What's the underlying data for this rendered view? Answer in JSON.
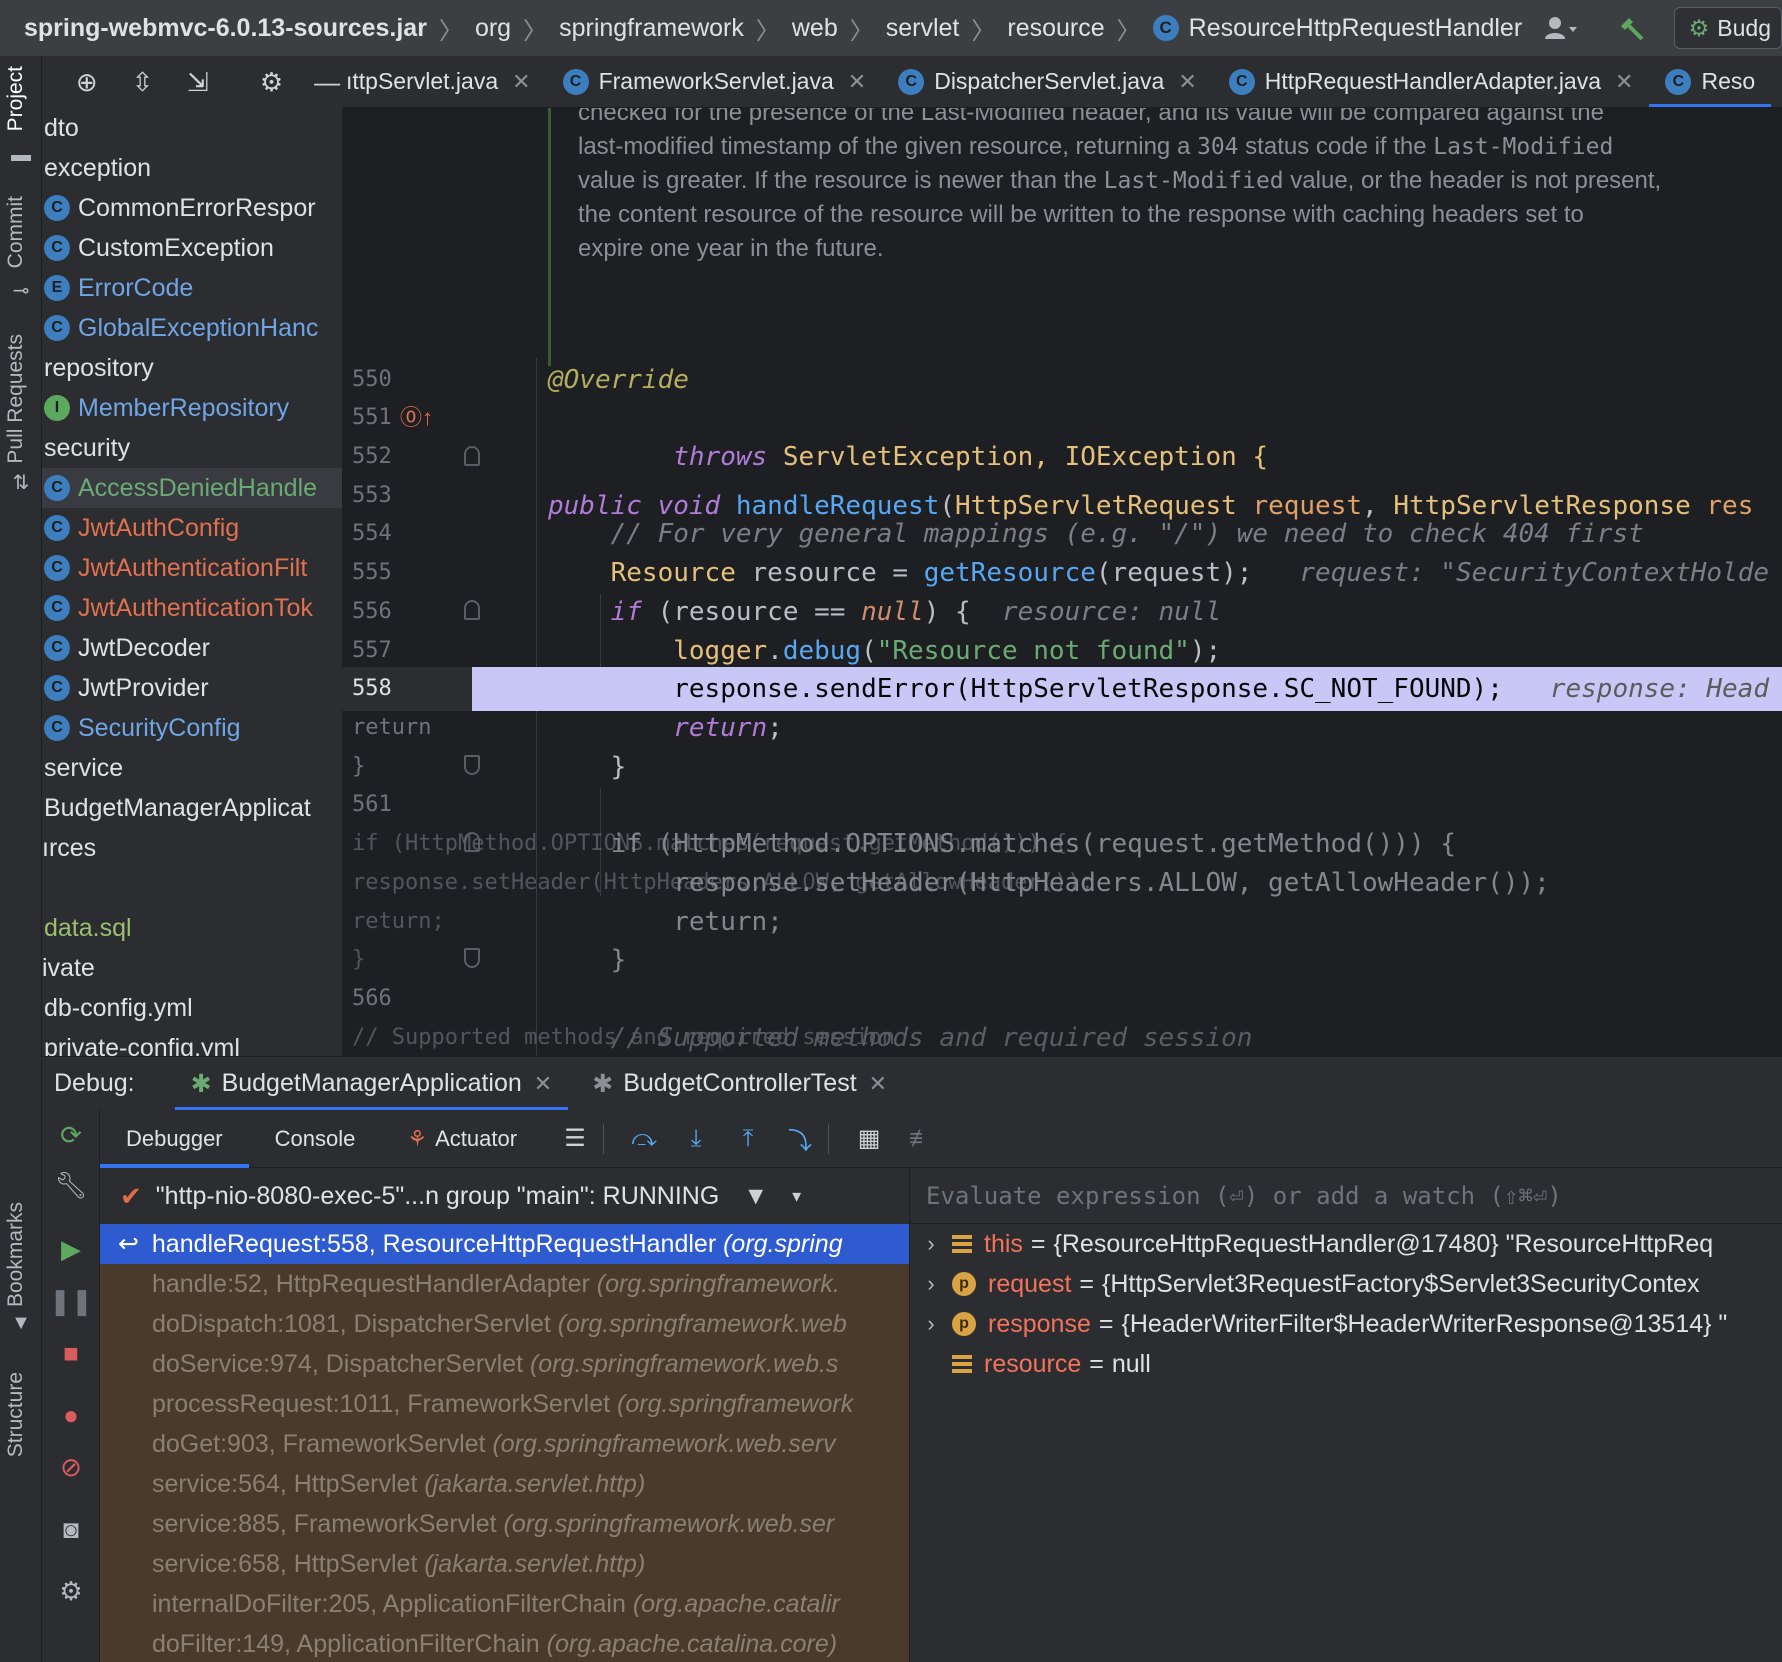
{
  "navbar": {
    "breadcrumbs": [
      "spring-webmvc-6.0.13-sources.jar",
      "org",
      "springframework",
      "web",
      "servlet",
      "resource",
      "ResourceHttpRequestHandler"
    ],
    "run_config": "Budg"
  },
  "left_strip": {
    "project": "Project",
    "commit": "Commit",
    "pull_requests": "Pull Requests",
    "bookmarks": "Bookmarks",
    "structure": "Structure"
  },
  "project_tree": [
    {
      "label": "dto",
      "icon": "folder",
      "color": "#dfe1e5",
      "indent": 2
    },
    {
      "label": "exception",
      "icon": "folder",
      "color": "#dfe1e5",
      "indent": 2
    },
    {
      "label": "CommonErrorRespor",
      "icon": "class",
      "color": "#dfe1e5",
      "indent": 2
    },
    {
      "label": "CustomException",
      "icon": "class",
      "color": "#dfe1e5",
      "indent": 2
    },
    {
      "label": "ErrorCode",
      "icon": "enum",
      "color": "#6fa5e6",
      "indent": 2
    },
    {
      "label": "GlobalExceptionHanc",
      "icon": "class",
      "color": "#6fa5e6",
      "indent": 2
    },
    {
      "label": "repository",
      "icon": "folder",
      "color": "#dfe1e5",
      "indent": 2
    },
    {
      "label": "MemberRepository",
      "icon": "interface",
      "color": "#6fa5e6",
      "indent": 2
    },
    {
      "label": "security",
      "icon": "folder",
      "color": "#dfe1e5",
      "indent": 2
    },
    {
      "label": "AccessDeniedHandle",
      "icon": "class",
      "color": "#6aab73",
      "indent": 2,
      "selected": true
    },
    {
      "label": "JwtAuthConfig",
      "icon": "class",
      "color": "#e0704f",
      "indent": 2
    },
    {
      "label": "JwtAuthenticationFilt",
      "icon": "class",
      "color": "#e0704f",
      "indent": 2
    },
    {
      "label": "JwtAuthenticationTok",
      "icon": "class",
      "color": "#e0704f",
      "indent": 2
    },
    {
      "label": "JwtDecoder",
      "icon": "class",
      "color": "#dfe1e5",
      "indent": 2
    },
    {
      "label": "JwtProvider",
      "icon": "class",
      "color": "#dfe1e5",
      "indent": 2
    },
    {
      "label": "SecurityConfig",
      "icon": "class",
      "color": "#6fa5e6",
      "indent": 2
    },
    {
      "label": "service",
      "icon": "folder",
      "color": "#dfe1e5",
      "indent": 2
    },
    {
      "label": "BudgetManagerApplicat",
      "icon": "folder",
      "color": "#dfe1e5",
      "indent": 2
    },
    {
      "label": "ırces",
      "icon": "none",
      "color": "#dfe1e5",
      "indent": 0
    },
    {
      "label": "",
      "icon": "none",
      "color": "#dfe1e5",
      "indent": 0
    },
    {
      "label": "data.sql",
      "icon": "file",
      "color": "#9bbf6e",
      "indent": 2
    },
    {
      "label": "ivate",
      "icon": "none",
      "color": "#dfe1e5",
      "indent": 0
    },
    {
      "label": "db-config.yml",
      "icon": "file",
      "color": "#dfe1e5",
      "indent": 2
    },
    {
      "label": "private-config.yml",
      "icon": "file",
      "color": "#dfe1e5",
      "indent": 2
    }
  ],
  "tabs": [
    {
      "label": "ıttpServlet.java",
      "icon": false
    },
    {
      "label": "FrameworkServlet.java",
      "icon": true
    },
    {
      "label": "DispatcherServlet.java",
      "icon": true
    },
    {
      "label": "HttpRequestHandlerAdapter.java",
      "icon": true
    },
    {
      "label": "Reso",
      "icon": true,
      "active": true
    }
  ],
  "doc_comment": {
    "line0": "checked for the presence of the Last-Modified header, and its value will be compared against the",
    "line1_a": "last-modified timestamp of the given resource, returning a ",
    "line1_code": "304",
    "line1_b": " status code if the ",
    "line1_code2": "Last-Modified",
    "line2_a": "value is greater. If the resource is newer than the ",
    "line2_code": "Last-Modified",
    "line2_b": " value, or the header is not present,",
    "line3": "the content resource of the resource will be written to the response with caching headers set to",
    "line4": "expire one year in the future."
  },
  "code": {
    "l550": "550",
    "l551": "551",
    "l552": "552",
    "l553": "553",
    "l554": "554",
    "l555": "555",
    "l556": "556",
    "l557": "557",
    "l558": "558",
    "l559": "return",
    "l560": "}",
    "l561": "561",
    "l562": "if (HttpMethod.OPTIONS.matches(request.getMethod())) {",
    "l563": "response.setHeader(HttpHeaders.ALLOW, getAllowHeader());",
    "l564": "return;",
    "l565": "}",
    "l566": "566",
    "l567": "// Supported methods and required session",
    "override": "@Override",
    "public": "public",
    "void": "void",
    "handleRequest": "handleRequest",
    "sig_type1": "HttpServletRequest",
    "sig_param1": "request",
    "sig_type2": "HttpServletResponse",
    "sig_param2": "res",
    "throws": "throws",
    "throws_types": "ServletException, IOException {",
    "comment554": "// For very general mappings (e.g. \"/\") we need to check 404 first",
    "l555_type": "Resource",
    "l555_mid": " resource = ",
    "l555_fn": "getResource",
    "l555_end": "(request);",
    "l555_hint": "request: \"SecurityContextHolde",
    "l556_if": "if",
    "l556_mid": " (resource == ",
    "l556_null": "null",
    "l556_end": ") {",
    "l556_hint": "resource: null",
    "l557_logger": "logger",
    "l557_fn": "debug",
    "l557_str": "\"Resource not found\"",
    "l557_end": ");",
    "l558_code": "response.sendError(HttpServletResponse.SC_NOT_FOUND);",
    "l558_hint": "response: Head"
  },
  "debug": {
    "label": "Debug:",
    "tab1": "BudgetManagerApplication",
    "tab2": "BudgetControllerTest",
    "toolbar_debugger": "Debugger",
    "toolbar_console": "Console",
    "toolbar_actuator": "Actuator",
    "thread": "\"http-nio-8080-exec-5\"...n group \"main\": RUNNING",
    "eval_placeholder": "Evaluate expression (⏎) or add a watch (⇧⌘⏎)",
    "frames": [
      {
        "method": "handleRequest:558, ResourceHttpRequestHandler",
        "pkg": "(org.spring",
        "selected": true
      },
      {
        "method": "handle:52, HttpRequestHandlerAdapter",
        "pkg": "(org.springframework."
      },
      {
        "method": "doDispatch:1081, DispatcherServlet",
        "pkg": "(org.springframework.web"
      },
      {
        "method": "doService:974, DispatcherServlet",
        "pkg": "(org.springframework.web.s"
      },
      {
        "method": "processRequest:1011, FrameworkServlet",
        "pkg": "(org.springframework"
      },
      {
        "method": "doGet:903, FrameworkServlet",
        "pkg": "(org.springframework.web.serv"
      },
      {
        "method": "service:564, HttpServlet",
        "pkg": "(jakarta.servlet.http)"
      },
      {
        "method": "service:885, FrameworkServlet",
        "pkg": "(org.springframework.web.ser"
      },
      {
        "method": "service:658, HttpServlet",
        "pkg": "(jakarta.servlet.http)"
      },
      {
        "method": "internalDoFilter:205, ApplicationFilterChain",
        "pkg": "(org.apache.catalir"
      },
      {
        "method": "doFilter:149, ApplicationFilterChain",
        "pkg": "(org.apache.catalina.core)"
      }
    ],
    "variables": [
      {
        "name": "this",
        "value": "{ResourceHttpRequestHandler@17480} \"ResourceHttpReq",
        "kind": "field",
        "expandable": true
      },
      {
        "name": "request",
        "value": "{HttpServlet3RequestFactory$Servlet3SecurityContex",
        "kind": "param",
        "expandable": true
      },
      {
        "name": "response",
        "value": "{HeaderWriterFilter$HeaderWriterResponse@13514} \"",
        "kind": "param",
        "expandable": true
      },
      {
        "name": "resource",
        "value": "null",
        "kind": "field",
        "expandable": false
      }
    ]
  },
  "colors": {
    "accent": "#3574f0",
    "execution_line": "#c9c7f5",
    "frame_selected": "#2f5bd0",
    "frame_library": "#4a3a2c"
  }
}
